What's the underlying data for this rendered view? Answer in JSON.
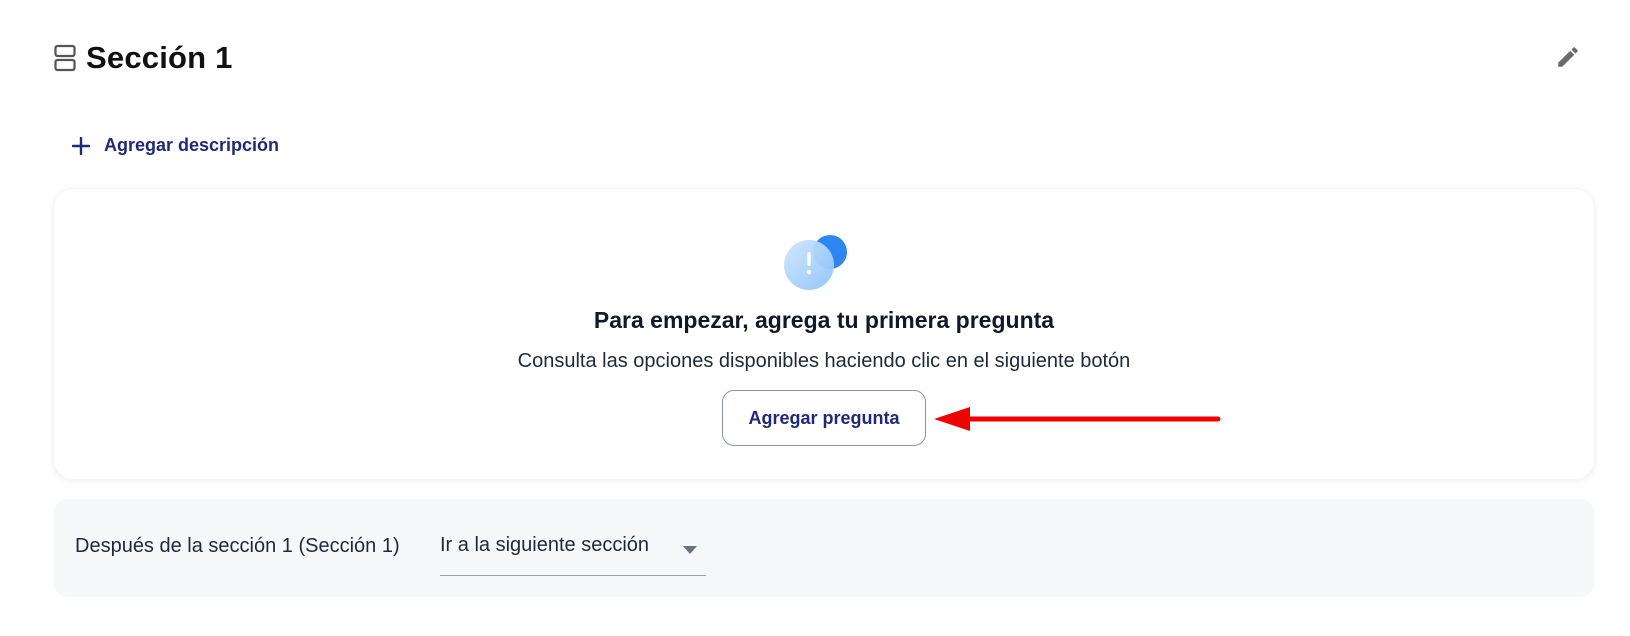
{
  "section": {
    "title": "Sección 1",
    "icon": "section-icon",
    "edit_icon": "pencil-icon"
  },
  "add_description": {
    "label": "Agregar descripción",
    "icon": "plus-icon"
  },
  "empty_state": {
    "icon": "alert-circle-icon",
    "title": "Para empezar, agrega tu primera pregunta",
    "subtitle": "Consulta las opciones disponibles haciendo clic en el siguiente botón",
    "button_label": "Agregar pregunta"
  },
  "annotation": {
    "arrow_color": "#ee0000"
  },
  "after_section": {
    "label": "Después de la sección 1 (Sección 1)",
    "selected_value": "Ir a la siguiente sección"
  },
  "colors": {
    "accent": "#1e2a78",
    "illus_light": "#a8d1fb",
    "illus_dark": "#2f86f0"
  }
}
